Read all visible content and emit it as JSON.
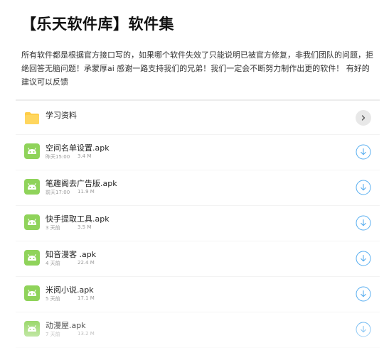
{
  "header": {
    "title": "【乐天软件库】软件集",
    "description": "所有软件都是根据官方接口写的，如果哪个软件失效了只能说明已被官方修复，非我们团队的问题，拒绝回答无脑问题！承蒙厚ai 感谢一路支持我们的兄弟！我们一定会不断努力制作出更的软件！ 有好的建议可以反馈"
  },
  "folder": {
    "name": "学习资料",
    "icon": "folder-icon",
    "color": "#ffcd48"
  },
  "files": [
    {
      "name": "空间名单设置.apk",
      "time": "昨天15:00",
      "size": "3.4 M"
    },
    {
      "name": "笔趣阁去广告版.apk",
      "time": "前天17:00",
      "size": "11.9 M"
    },
    {
      "name": "快手提取工具.apk",
      "time": "3 天前",
      "size": "3.5 M"
    },
    {
      "name": "知音漫客 .apk",
      "time": "4 天前",
      "size": "22.4 M"
    },
    {
      "name": "米阅小说.apk",
      "time": "5 天前",
      "size": "17.1 M"
    },
    {
      "name": "动漫屋.apk",
      "time": "7 天前",
      "size": "13.2 M"
    }
  ],
  "colors": {
    "android_green": "#8fd35a",
    "download_blue": "#5aaff0"
  }
}
